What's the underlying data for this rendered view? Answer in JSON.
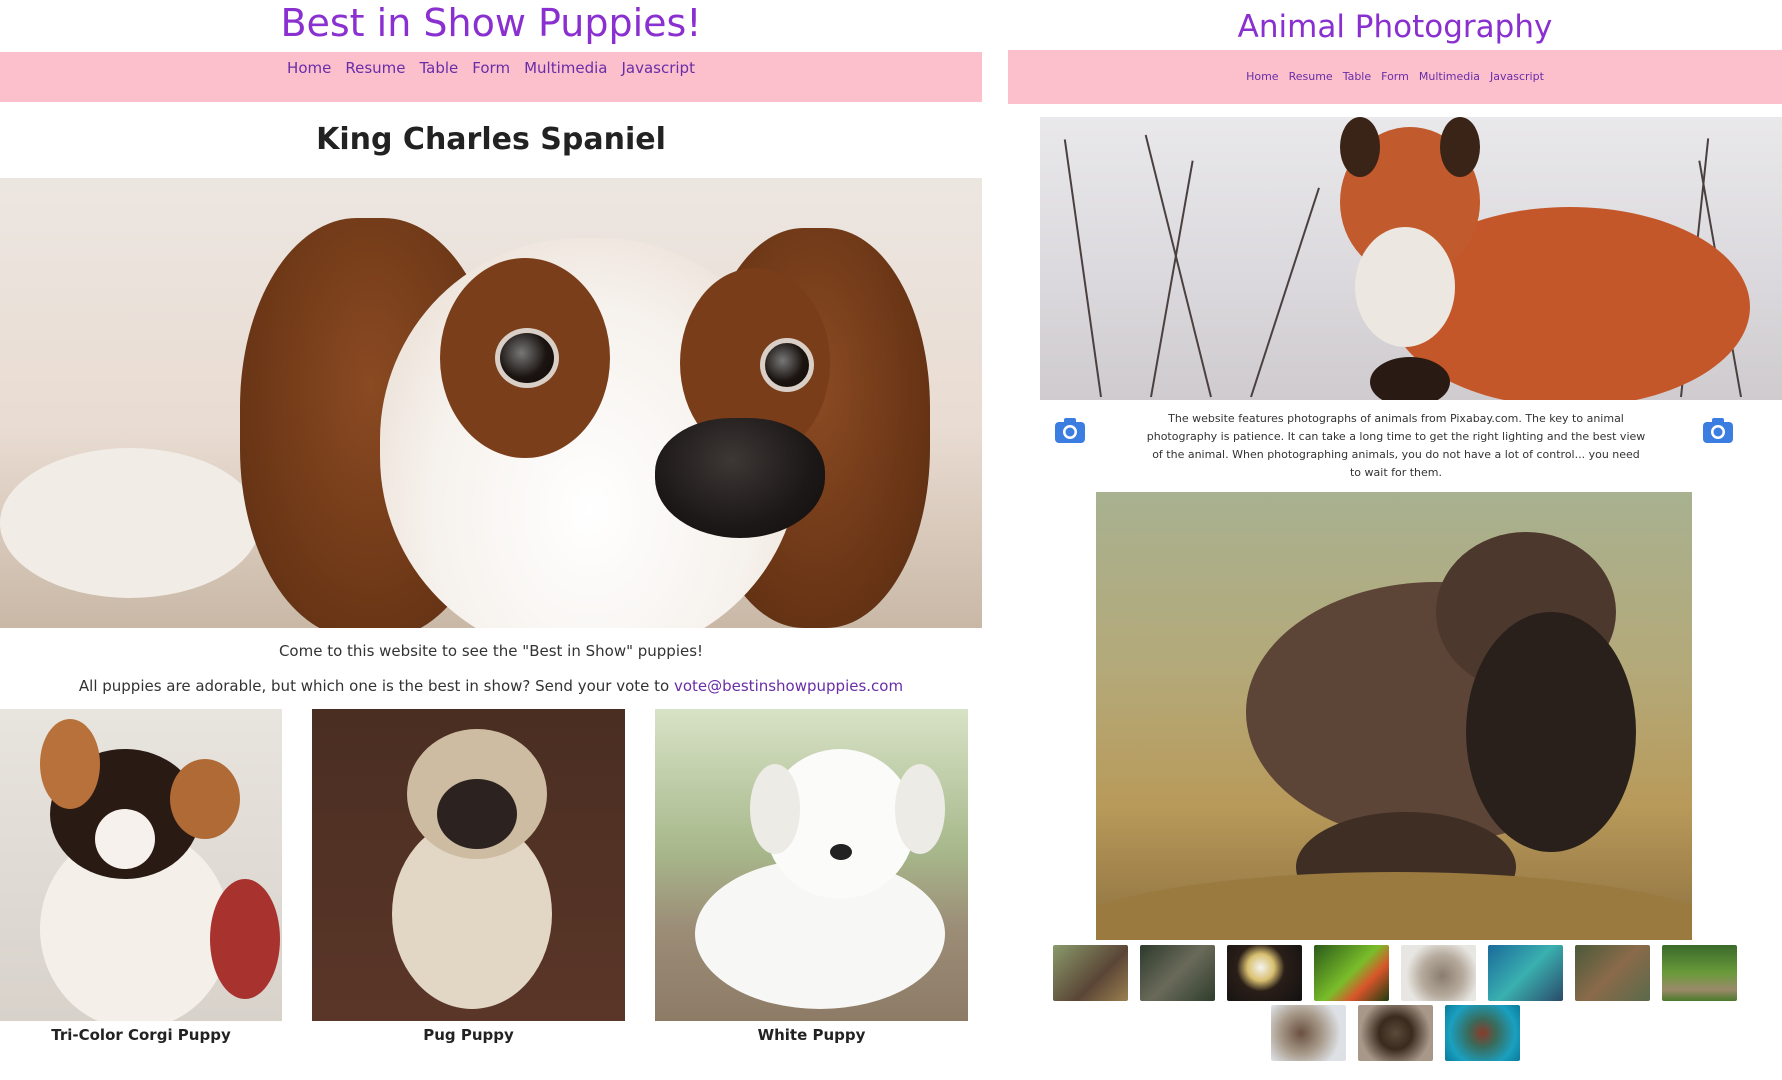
{
  "left": {
    "site_title": "Best in Show Puppies!",
    "nav": [
      "Home",
      "Resume",
      "Table",
      "Form",
      "Multimedia",
      "Javascript"
    ],
    "page_heading": "King Charles Spaniel",
    "intro_text": "Come to this website to see the \"Best in Show\" puppies!",
    "vote_text": "All puppies are adorable, but which one is the best in show? Send your vote to ",
    "vote_email": "vote@bestinshowpuppies.com",
    "puppies": [
      {
        "label": "Tri-Color Corgi Puppy"
      },
      {
        "label": "Pug Puppy"
      },
      {
        "label": "White Puppy"
      }
    ]
  },
  "right": {
    "site_title": "Animal Photography",
    "nav": [
      "Home",
      "Resume",
      "Table",
      "Form",
      "Multimedia",
      "Javascript"
    ],
    "about_text": "The website features photographs of animals from Pixabay.com. The key to animal photography is patience. It can take a long time to get the right lighting and the best view of the animal. When photographing animals, you do not have a lot of control... you need to wait for them.",
    "thumbnails": [
      "bison",
      "deer",
      "eagle",
      "frog",
      "hedgehog",
      "lizard",
      "otter",
      "rabbit",
      "ram",
      "spider",
      "turtle"
    ]
  },
  "colors": {
    "title": "#8a2fd0",
    "nav_bg": "#fbc0cc",
    "link": "#6a2da8",
    "camera_icon": "#3b7de0"
  }
}
